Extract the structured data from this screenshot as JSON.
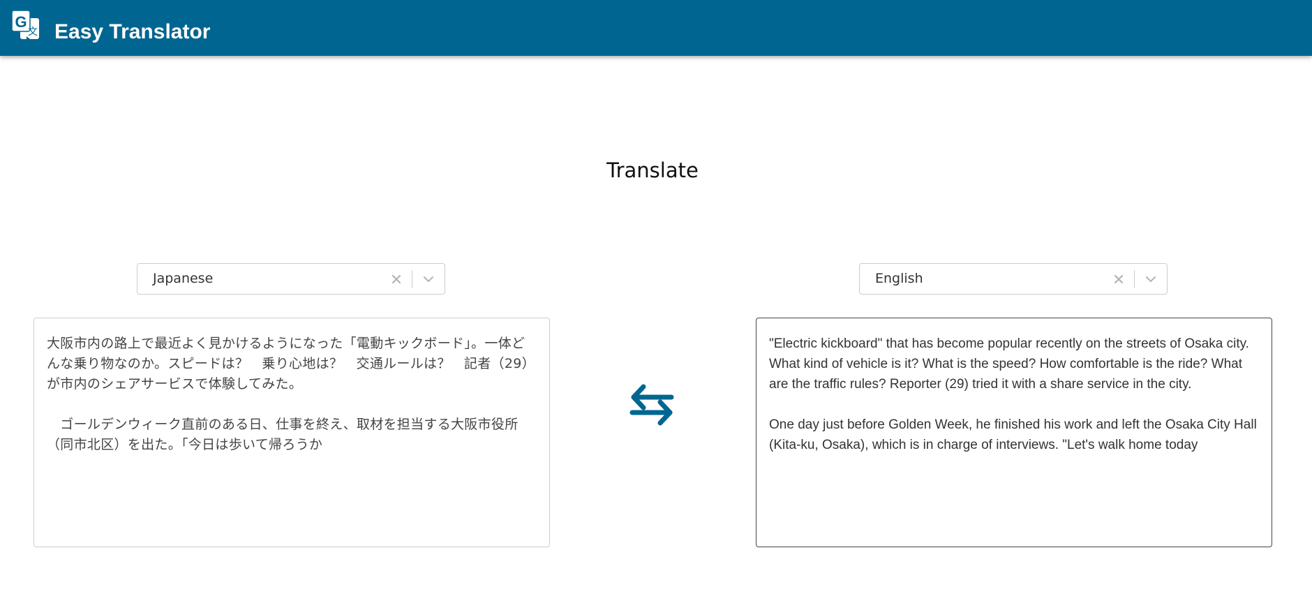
{
  "header": {
    "title": "Easy Translator",
    "background_color": "#006691",
    "logo_icon": "translate-icon"
  },
  "main": {
    "title": "Translate"
  },
  "source": {
    "language": "Japanese",
    "text": "大阪市内の路上で最近よく見かけるようになった「電動キックボード」。一体どんな乗り物なのか。スピードは？　乗り心地は？　交通ルールは？　記者（29）が市内のシェアサービスで体験してみた。\n\n　ゴールデンウィーク直前のある日、仕事を終え、取材を担当する大阪市役所（同市北区）を出た。「今日は歩いて帰ろうか"
  },
  "target": {
    "language": "English",
    "text": "\"Electric kickboard\" that has become popular recently on the streets of Osaka city. What kind of vehicle is it? What is the speed? How comfortable is the ride? What are the traffic rules? Reporter (29) tried it with a share service in the city.\n\nOne day just before Golden Week, he finished his work and left the Osaka City Hall (Kita-ku, Osaka), which is in charge of interviews. \"Let's walk home today"
  },
  "swap_icon": "swap-arrows-icon",
  "accent_color": "#006691"
}
